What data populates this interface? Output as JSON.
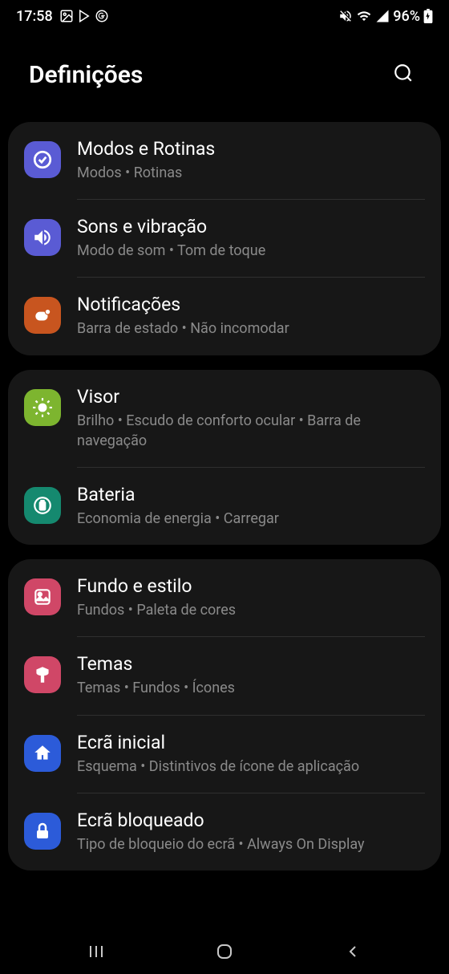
{
  "statusBar": {
    "time": "17:58",
    "battery": "96%"
  },
  "header": {
    "title": "Definições"
  },
  "groups": [
    {
      "items": [
        {
          "id": "modos-rotinas",
          "title": "Modos e Rotinas",
          "subtitle": "Modos  •  Rotinas",
          "iconColor": "#5a5bd4"
        },
        {
          "id": "sons-vibracao",
          "title": "Sons e vibração",
          "subtitle": "Modo de som  •  Tom de toque",
          "iconColor": "#5a5bd4"
        },
        {
          "id": "notificacoes",
          "title": "Notificações",
          "subtitle": "Barra de estado  •  Não incomodar",
          "iconColor": "#c8551f"
        }
      ]
    },
    {
      "items": [
        {
          "id": "visor",
          "title": "Visor",
          "subtitle": "Brilho  •  Escudo de conforto ocular  •  Barra de navegação",
          "iconColor": "#7db52f"
        },
        {
          "id": "bateria",
          "title": "Bateria",
          "subtitle": "Economia de energia  •  Carregar",
          "iconColor": "#15896f"
        }
      ]
    },
    {
      "items": [
        {
          "id": "fundo-estilo",
          "title": "Fundo e estilo",
          "subtitle": "Fundos  •  Paleta de cores",
          "iconColor": "#d04767"
        },
        {
          "id": "temas",
          "title": "Temas",
          "subtitle": "Temas  •  Fundos  •  Ícones",
          "iconColor": "#d04767"
        },
        {
          "id": "ecra-inicial",
          "title": "Ecrã inicial",
          "subtitle": "Esquema  •  Distintivos de ícone de aplicação",
          "iconColor": "#2c5bd9"
        },
        {
          "id": "ecra-bloqueado",
          "title": "Ecrã bloqueado",
          "subtitle": "Tipo de bloqueio do ecrã  •  Always On Display",
          "iconColor": "#2c5bd9"
        }
      ]
    }
  ]
}
